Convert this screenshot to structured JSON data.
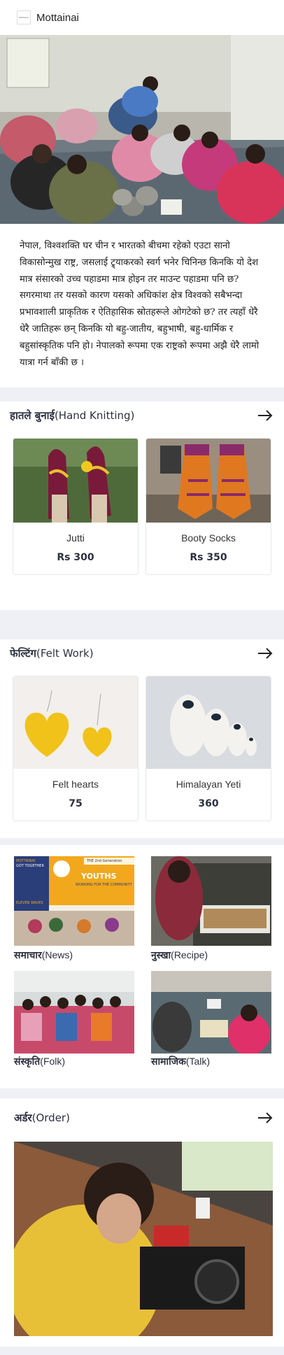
{
  "header": {
    "brand": "Mottainai",
    "logo_text": "Mottainai"
  },
  "intro": {
    "text": "नेपाल, विश्वशक्ति घर चीन र भारतको बीचमा रहेको एउटा सानो विकासोन्मुख राष्ट्र, जसलाई ट्र्याकरको स्वर्ग भनेर चिनिन्छ किनकि यो देश मात्र संसारको उच्च पहाडमा मात्र होइन तर माउन्ट पहाडमा पनि छ? सगरमाथा तर यसको कारण यसको अधिकांश क्षेत्र विश्वको सबैभन्दा प्रभावशाली प्राकृतिक र ऐतिहासिक स्रोतहरूले ओगटेको छ? तर त्यहाँ धेरै धेरै जातिहरू छन् किनकि यो बहु-जातीय, बहुभाषी, बहु-धार्मिक र बहुसांस्कृतिक पनि हो। नेपालको रूपमा एक राष्ट्रको रूपमा अझै धेरै लामो यात्रा गर्न बाँकी छ ।"
  },
  "knitting": {
    "title_np": "हातले बुनाई",
    "title_en": "(Hand Knitting)",
    "items": [
      {
        "name": "Jutti",
        "price": "Rs 300"
      },
      {
        "name": "Booty Socks",
        "price": "Rs 350"
      }
    ]
  },
  "felting": {
    "title_np": "फेल्टिंग",
    "title_en": "(Felt Work)",
    "items": [
      {
        "name": "Felt hearts",
        "price": "75"
      },
      {
        "name": "Himalayan Yeti",
        "price": "360"
      }
    ]
  },
  "grid": {
    "poster": {
      "line1": "THE 2nd Generation",
      "line2": "YOUTHS",
      "line3": "WORKING FOR THE COMMUNITY",
      "line4": "ELEVEN WAVES",
      "left_top": "MOTTAINAI",
      "left_sub": "GOT TOGETHER"
    },
    "tiles": [
      {
        "np": "समाचार",
        "en": "(News)"
      },
      {
        "np": "नुस्खा",
        "en": "(Recipe)"
      },
      {
        "np": "संस्कृति",
        "en": "(Folk)"
      },
      {
        "np": "सामाजिक",
        "en": "(Talk)"
      }
    ]
  },
  "order": {
    "title_np": "अर्डर",
    "title_en": "(Order)"
  },
  "icons": {
    "arrow": "arrow-right-icon",
    "logo": "mottainai-logo"
  },
  "colors": {
    "accent": "#2d3140",
    "background": "#eef0f6",
    "card_border": "#e6e8ee"
  }
}
